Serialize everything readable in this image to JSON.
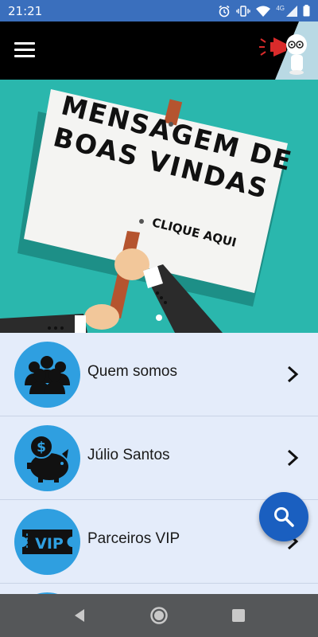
{
  "status_bar": {
    "time": "21:21",
    "network_label": "4G",
    "icons": [
      "alarm-icon",
      "vibrate-icon",
      "wifi-icon",
      "signal-icon",
      "battery-icon"
    ]
  },
  "app_bar": {
    "menu_icon": "hamburger-menu-icon",
    "logo": "megaphone-mascot-logo"
  },
  "banner": {
    "sign_lines": [
      "MENSAGEM DE",
      "BOAS VINDAS"
    ],
    "cta": "CLIQUE AQUI",
    "slide_index": 1,
    "slide_count": 1
  },
  "menu_items": [
    {
      "label": "Quem somos",
      "icon": "group-people-icon"
    },
    {
      "label": "Júlio Santos",
      "icon": "piggy-bank-dollar-icon"
    },
    {
      "label": "Parceiros VIP",
      "icon": "vip-ticket-icon"
    }
  ],
  "fab": {
    "icon": "search-icon"
  },
  "nav_bar": {
    "icons": [
      "back-icon",
      "home-icon",
      "recents-icon"
    ]
  },
  "colors": {
    "status_bar": "#3a6fbd",
    "app_bar": "#000000",
    "banner_bg": "#2ab7ad",
    "list_bg": "#e4ecfa",
    "avatar": "#2f9fe0",
    "fab": "#1a5fc0",
    "nav_bar": "#555759"
  }
}
